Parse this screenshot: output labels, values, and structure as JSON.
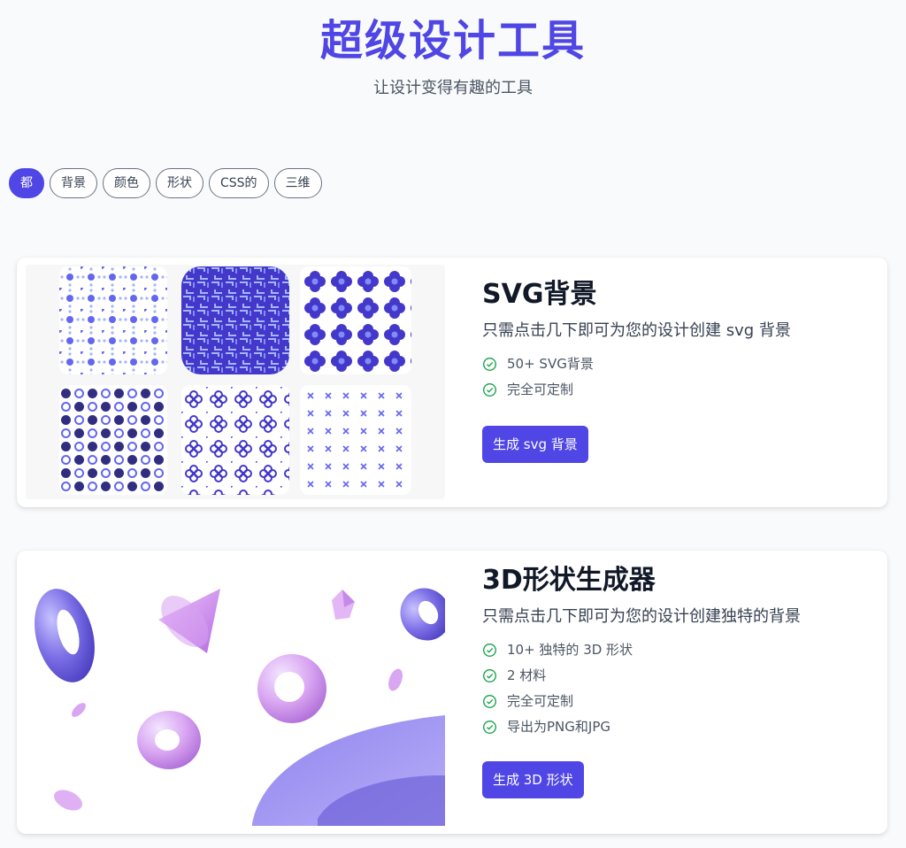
{
  "header": {
    "title": "超级设计工具",
    "subtitle": "让设计变得有趣的工具"
  },
  "filters": [
    {
      "label": "都",
      "active": true
    },
    {
      "label": "背景",
      "active": false
    },
    {
      "label": "颜色",
      "active": false
    },
    {
      "label": "形状",
      "active": false
    },
    {
      "label": "CSS的",
      "active": false
    },
    {
      "label": "三维",
      "active": false
    }
  ],
  "cards": [
    {
      "title": "SVG背景",
      "description": "只需点击几下即可为您的设计创建 svg 背景",
      "features": [
        "50+ SVG背景",
        "完全可定制"
      ],
      "button": "生成 svg 背景"
    },
    {
      "title": "3D形状生成器",
      "description": "只需点击几下即可为您的设计创建独特的背景",
      "features": [
        "10+ 独特的 3D 形状",
        "2 材料",
        "完全可定制",
        "导出为PNG和JPG"
      ],
      "button": "生成 3D 形状"
    }
  ],
  "colors": {
    "accent": "#4f46e5",
    "check": "#16a34a",
    "pattern_purple": "#6366f1",
    "shape_violet": "#c084fc"
  }
}
